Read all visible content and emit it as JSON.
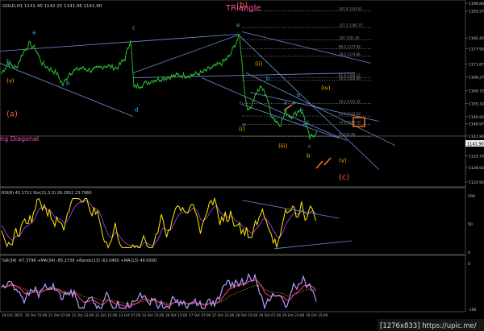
{
  "header": {
    "symbol_info": "GOLD,H1  1141.40  1142.25  1141.06  1141.90",
    "title": "TRiangle",
    "title_color": "#ff4fb4"
  },
  "colors": {
    "background": "#000000",
    "price_line": "#2fbf2f",
    "trend_line": "#6f8fd9",
    "fib_line": "#8a8a8a",
    "wave_cyan": "#3fb8ff",
    "wave_orange": "#ffb000",
    "wave_red": "#ff5a3a",
    "wave_magenta": "#ff4fb4",
    "wave_white": "#ffffff",
    "rsi_line": "#ffee00",
    "ma_red": "#ff3030",
    "ma_purple": "#b44cff",
    "osc_fast": "#b0a0ff",
    "osc_slow": "#ff3080"
  },
  "chart_data": [
    {
      "type": "line",
      "panel": "price",
      "y_ticks": [
        "1196.80",
        "1193.57",
        "1182.42",
        "1177.95",
        "1171.67",
        "1166.27",
        "1160.72",
        "1155.32",
        "1149.92",
        "1146.97",
        "1141.90",
        "1139.12",
        "1133.72",
        "1128.92",
        "1122.92"
      ],
      "ylim": [
        1122.92,
        1196.8
      ],
      "fib_levels": [
        {
          "label": "161.8  1193.61",
          "value": 1193.61
        },
        {
          "label": "127.2  1186.75",
          "value": 1186.75
        },
        {
          "label": "100  1181.60",
          "value": 1181.6
        },
        {
          "label": "88.6  1177.96",
          "value": 1177.96
        },
        {
          "label": "78.6  1174.86",
          "value": 1174.86
        },
        {
          "label": "61.8  1166.12",
          "value": 1166.12
        },
        {
          "label": "50.0  1164.90",
          "value": 1164.9
        },
        {
          "label": "38.2  1155.32",
          "value": 1155.32
        },
        {
          "label": "23.6  1150.20",
          "value": 1150.2
        },
        {
          "label": "14.6  1146.70",
          "value": 1146.7
        },
        {
          "label": "0  1141.80",
          "value": 1141.8
        }
      ],
      "current_price": "1141.90",
      "wave_labels": [
        {
          "text": "a",
          "color": "cyan",
          "x": "c1",
          "y": 1184
        },
        {
          "text": "b",
          "color": "cyan",
          "x": "c0",
          "y": 1172
        },
        {
          "text": "(v)",
          "color": "orange",
          "x": "c0",
          "y": 1164
        },
        {
          "text": "b",
          "color": "cyan",
          "x": "c2",
          "y": 1163
        },
        {
          "text": "c",
          "color": "cyan",
          "x": "c3",
          "y": 1186
        },
        {
          "text": "d",
          "color": "cyan",
          "x": "c4",
          "y": 1152
        },
        {
          "text": "e",
          "color": "cyan",
          "x": "c5",
          "y": 1187
        },
        {
          "text": "(b)",
          "color": "red",
          "x": "c5",
          "y": 1195
        },
        {
          "text": "(a)",
          "color": "red",
          "x": "c0",
          "y": 1150
        },
        {
          "text": "(ii)",
          "color": "orange",
          "x": "c6",
          "y": 1171
        },
        {
          "text": "(i)",
          "color": "orange",
          "x": "c7",
          "y": 1144
        },
        {
          "text": "(iii)",
          "color": "orange",
          "x": "c8",
          "y": 1137
        },
        {
          "text": "(iv)",
          "color": "orange",
          "x": "c9",
          "y": 1161
        },
        {
          "text": "(v)",
          "color": "orange",
          "x": "c10",
          "y": 1131
        },
        {
          "text": "(c)",
          "color": "red",
          "x": "c10",
          "y": 1124
        }
      ],
      "annotation_left": "ng Diagonal"
    },
    {
      "type": "line",
      "panel": "rsi",
      "header": "RSI(8) 45.1711   Sto(21,3,3) 26.2952  23.7960",
      "y_ticks": [
        "100",
        "50",
        "0"
      ],
      "ylim": [
        0,
        100
      ]
    },
    {
      "type": "line",
      "panel": "oscillator",
      "header": "%R(34) -67.3796   +MA(34) -85.2739   +Bands(13) -63.0465   +MA(13) 49.0000",
      "y_ticks": [
        "0",
        "-100"
      ],
      "ylim": [
        -100,
        0
      ]
    }
  ],
  "time_axis": [
    "19 Oct 2015",
    "20 Oct 15:00",
    "21 Oct 07:00",
    "21 Oct 23:00",
    "22 Oct 15:00",
    "23 Oct 07:00",
    "23 Oct 23:00",
    "26 Oct 15:00",
    "27 Oct 07:00",
    "27 Oct 23:00",
    "28 Oct 15:00",
    "29 Oct 07:00",
    "29 Oct 23:00",
    "30 Oct 15:00"
  ],
  "watermark": "[1276x833] https://upic.me/"
}
